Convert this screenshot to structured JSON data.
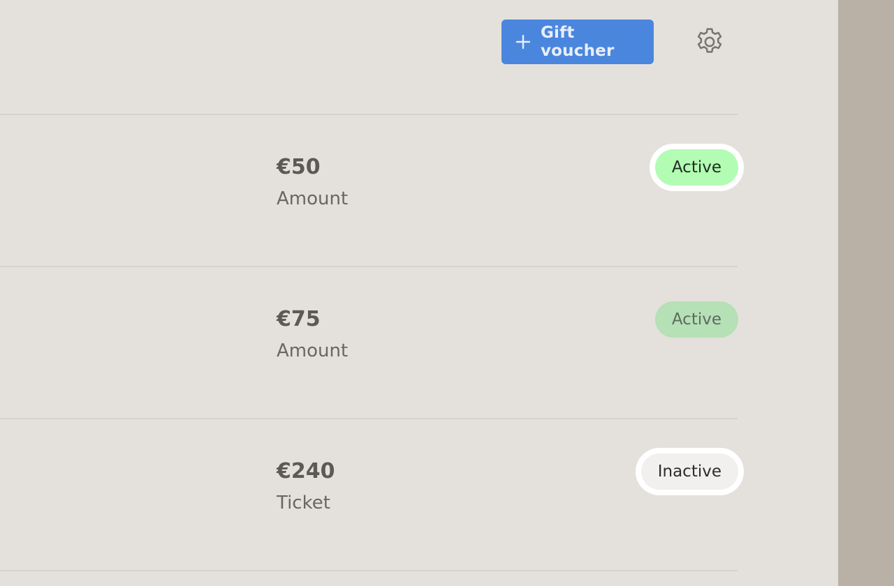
{
  "toolbar": {
    "gift_voucher_label": "Gift voucher",
    "gift_voucher_icon": "plus-icon",
    "settings_icon": "gear-icon"
  },
  "vouchers": [
    {
      "amount": "€50",
      "type": "Amount",
      "status": "Active"
    },
    {
      "amount": "€75",
      "type": "Amount",
      "status": "Active"
    },
    {
      "amount": "€240",
      "type": "Ticket",
      "status": "Inactive"
    }
  ],
  "colors": {
    "primary_button": "#4a86dd",
    "active_badge": "#b2fcb4",
    "active_badge_muted": "#b6e0b6",
    "inactive_badge": "#f1f0ef",
    "background": "#e4e1dd",
    "gutter": "#b9b1a6"
  }
}
